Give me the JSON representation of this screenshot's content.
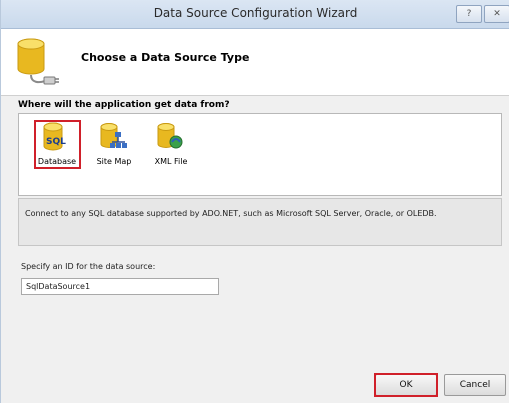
{
  "window": {
    "title": "Data Source Configuration Wizard",
    "help_glyph": "?",
    "close_glyph": "✕"
  },
  "header": {
    "title": "Choose a Data Source Type",
    "icon": "database-plug-icon"
  },
  "source_types": {
    "prompt": "Where will the application get data from?",
    "items": [
      {
        "label": "Database",
        "icon": "sql-database-icon",
        "badge": "SQL",
        "selected": true
      },
      {
        "label": "Site Map",
        "icon": "site-map-icon",
        "selected": false
      },
      {
        "label": "XML File",
        "icon": "xml-file-icon",
        "selected": false
      }
    ]
  },
  "description": {
    "text": "Connect to any SQL database supported by ADO.NET, such as Microsoft SQL Server, Oracle, or OLEDB."
  },
  "id_field": {
    "label": "Specify an ID for the data source:",
    "value": "SqlDataSource1"
  },
  "buttons": {
    "ok": "OK",
    "cancel": "Cancel"
  },
  "colors": {
    "highlight": "#d0202a",
    "db_gold": "#e8b820",
    "title_bar": "#cfdcee"
  }
}
